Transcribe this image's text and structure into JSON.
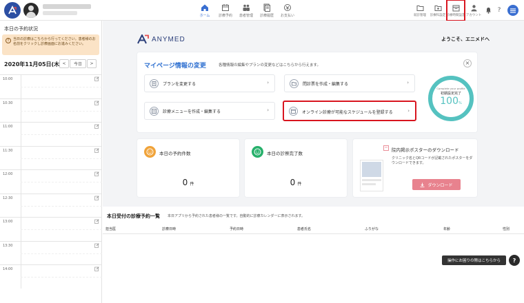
{
  "nav": {
    "items": [
      {
        "label": "ホーム",
        "icon": "home-icon"
      },
      {
        "label": "診療予約",
        "icon": "calendar-icon"
      },
      {
        "label": "患者管理",
        "icon": "patients-icon"
      },
      {
        "label": "診療履歴",
        "icon": "history-icon"
      },
      {
        "label": "お支払い",
        "icon": "payment-icon"
      }
    ],
    "right_items": [
      {
        "label": "就診管理",
        "icon": "folder-icon"
      },
      {
        "label": "診療科設定",
        "icon": "folder-settings-icon"
      },
      {
        "label": "診療時間設定",
        "icon": "schedule-icon"
      },
      {
        "label": "アカウント",
        "icon": "account-icon"
      }
    ]
  },
  "sidebar": {
    "title": "本日の予約状況",
    "notice": "当日の診療はこちらから行ってください。患者様のお名前をクリックし診療画面にお進みください。",
    "date": "2020年11月05日(木)",
    "prev": "<",
    "today": "今日",
    "next": ">",
    "times": [
      "10:00",
      "10:30",
      "11:00",
      "11:30",
      "12:00",
      "12:30",
      "13:00",
      "13:30",
      "14:00"
    ]
  },
  "brand": {
    "name": "ANYMED"
  },
  "welcome": "ようこそ、エニメドへ",
  "mypage": {
    "title": "マイページ情報の変更",
    "subtitle": "各種情報の編集やプランの変更などはこちらから行えます。",
    "close": "×",
    "actions": [
      {
        "label": "プランを変更する"
      },
      {
        "label": "問診票を作成・編集する"
      },
      {
        "label": "診療メニューを作成・編集する"
      },
      {
        "label": "オンライン診療が可能なスケジュールを登録する"
      }
    ],
    "chevron": "›",
    "profile": {
      "caption": "Complete your profile",
      "label": "初期設定完了",
      "value": "100",
      "unit": "%",
      "progress": 1.0
    }
  },
  "stats": [
    {
      "title": "本日の予約件数",
      "value": "0",
      "unit": "件"
    },
    {
      "title": "本日の診察完了数",
      "value": "0",
      "unit": "件"
    }
  ],
  "poster": {
    "title": "院内掲示ポスターのダウンロード",
    "description": "クリニック名とQRコードが記載されたポスターをダウンロードできます。",
    "button": "ダウンロード"
  },
  "list": {
    "title": "本日受付の診療予約一覧",
    "subtitle": "本日アプリから予約された患者様の一覧です。自動的に診療カレンダーに表示されます。",
    "columns": [
      "担当医",
      "診療日時",
      "予約日時",
      "患者氏名",
      "ふりがな",
      "年齢",
      "性別"
    ]
  },
  "help": {
    "label": "操作にお困りの際はこちらから",
    "icon": "?"
  },
  "colors": {
    "accent": "#3a6fd1",
    "highlight": "#d8141e",
    "ring": "#55c2c0",
    "download": "#e8828e"
  }
}
